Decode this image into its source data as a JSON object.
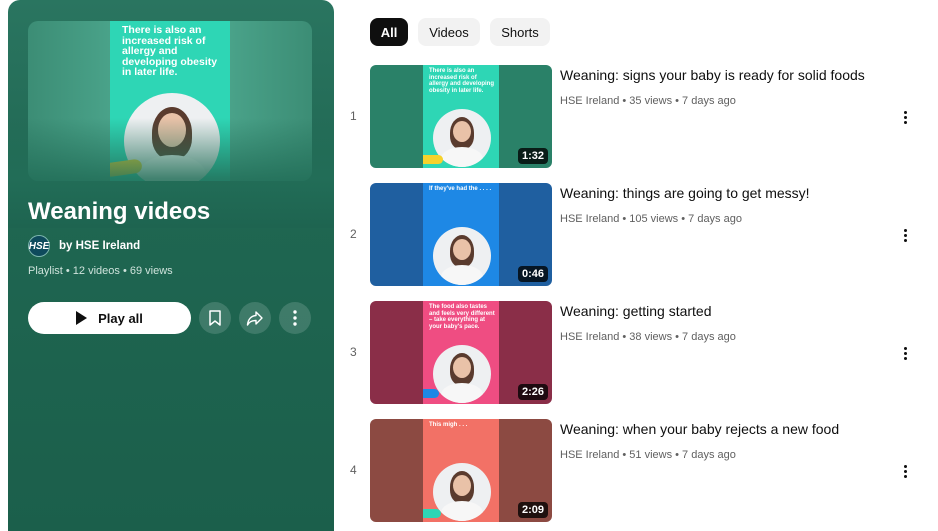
{
  "playlist": {
    "title": "Weaning videos",
    "owner": "by HSE Ireland",
    "owner_avatar_text": "HSE",
    "meta": "Playlist • 12 videos • 69 views",
    "play_all_label": "Play all",
    "hero_caption": "There is also an increased risk of allergy and developing obesity in later life."
  },
  "chips": [
    {
      "label": "All",
      "active": true
    },
    {
      "label": "Videos",
      "active": false
    },
    {
      "label": "Shorts",
      "active": false
    }
  ],
  "videos": [
    {
      "index": "1",
      "title": "Weaning: signs your baby is ready for solid foods",
      "meta": "HSE Ireland • 35 views • 7 days ago",
      "duration": "1:32",
      "thumb_caption": "There is also an increased risk of allergy and developing obesity in later life."
    },
    {
      "index": "2",
      "title": "Weaning: things are going to get messy!",
      "meta": "HSE Ireland • 105 views • 7 days ago",
      "duration": "0:46",
      "thumb_caption": "If they've had the . . . ."
    },
    {
      "index": "3",
      "title": "Weaning: getting started",
      "meta": "HSE Ireland • 38 views • 7 days ago",
      "duration": "2:26",
      "thumb_caption": "The food also tastes and feels very different – take everything at your baby's pace."
    },
    {
      "index": "4",
      "title": "Weaning: when your baby rejects a new food",
      "meta": "HSE Ireland • 51 views • 7 days ago",
      "duration": "2:09",
      "thumb_caption": "This migh . . ."
    }
  ],
  "icons": {
    "save": "bookmark-icon",
    "share": "share-icon",
    "more": "more-vert-icon",
    "play": "play-icon"
  },
  "colors": {
    "panel": "#1f6651",
    "thumb1_bg": "#2a8168",
    "thumb1_inner": "#2ed6b5",
    "thumb2_bg": "#1f5fa0",
    "thumb2_inner": "#1e88e5",
    "thumb3_bg": "#8a2e48",
    "thumb3_inner": "#ef4d82",
    "thumb4_bg": "#8c4a42",
    "thumb4_inner": "#f27166"
  }
}
